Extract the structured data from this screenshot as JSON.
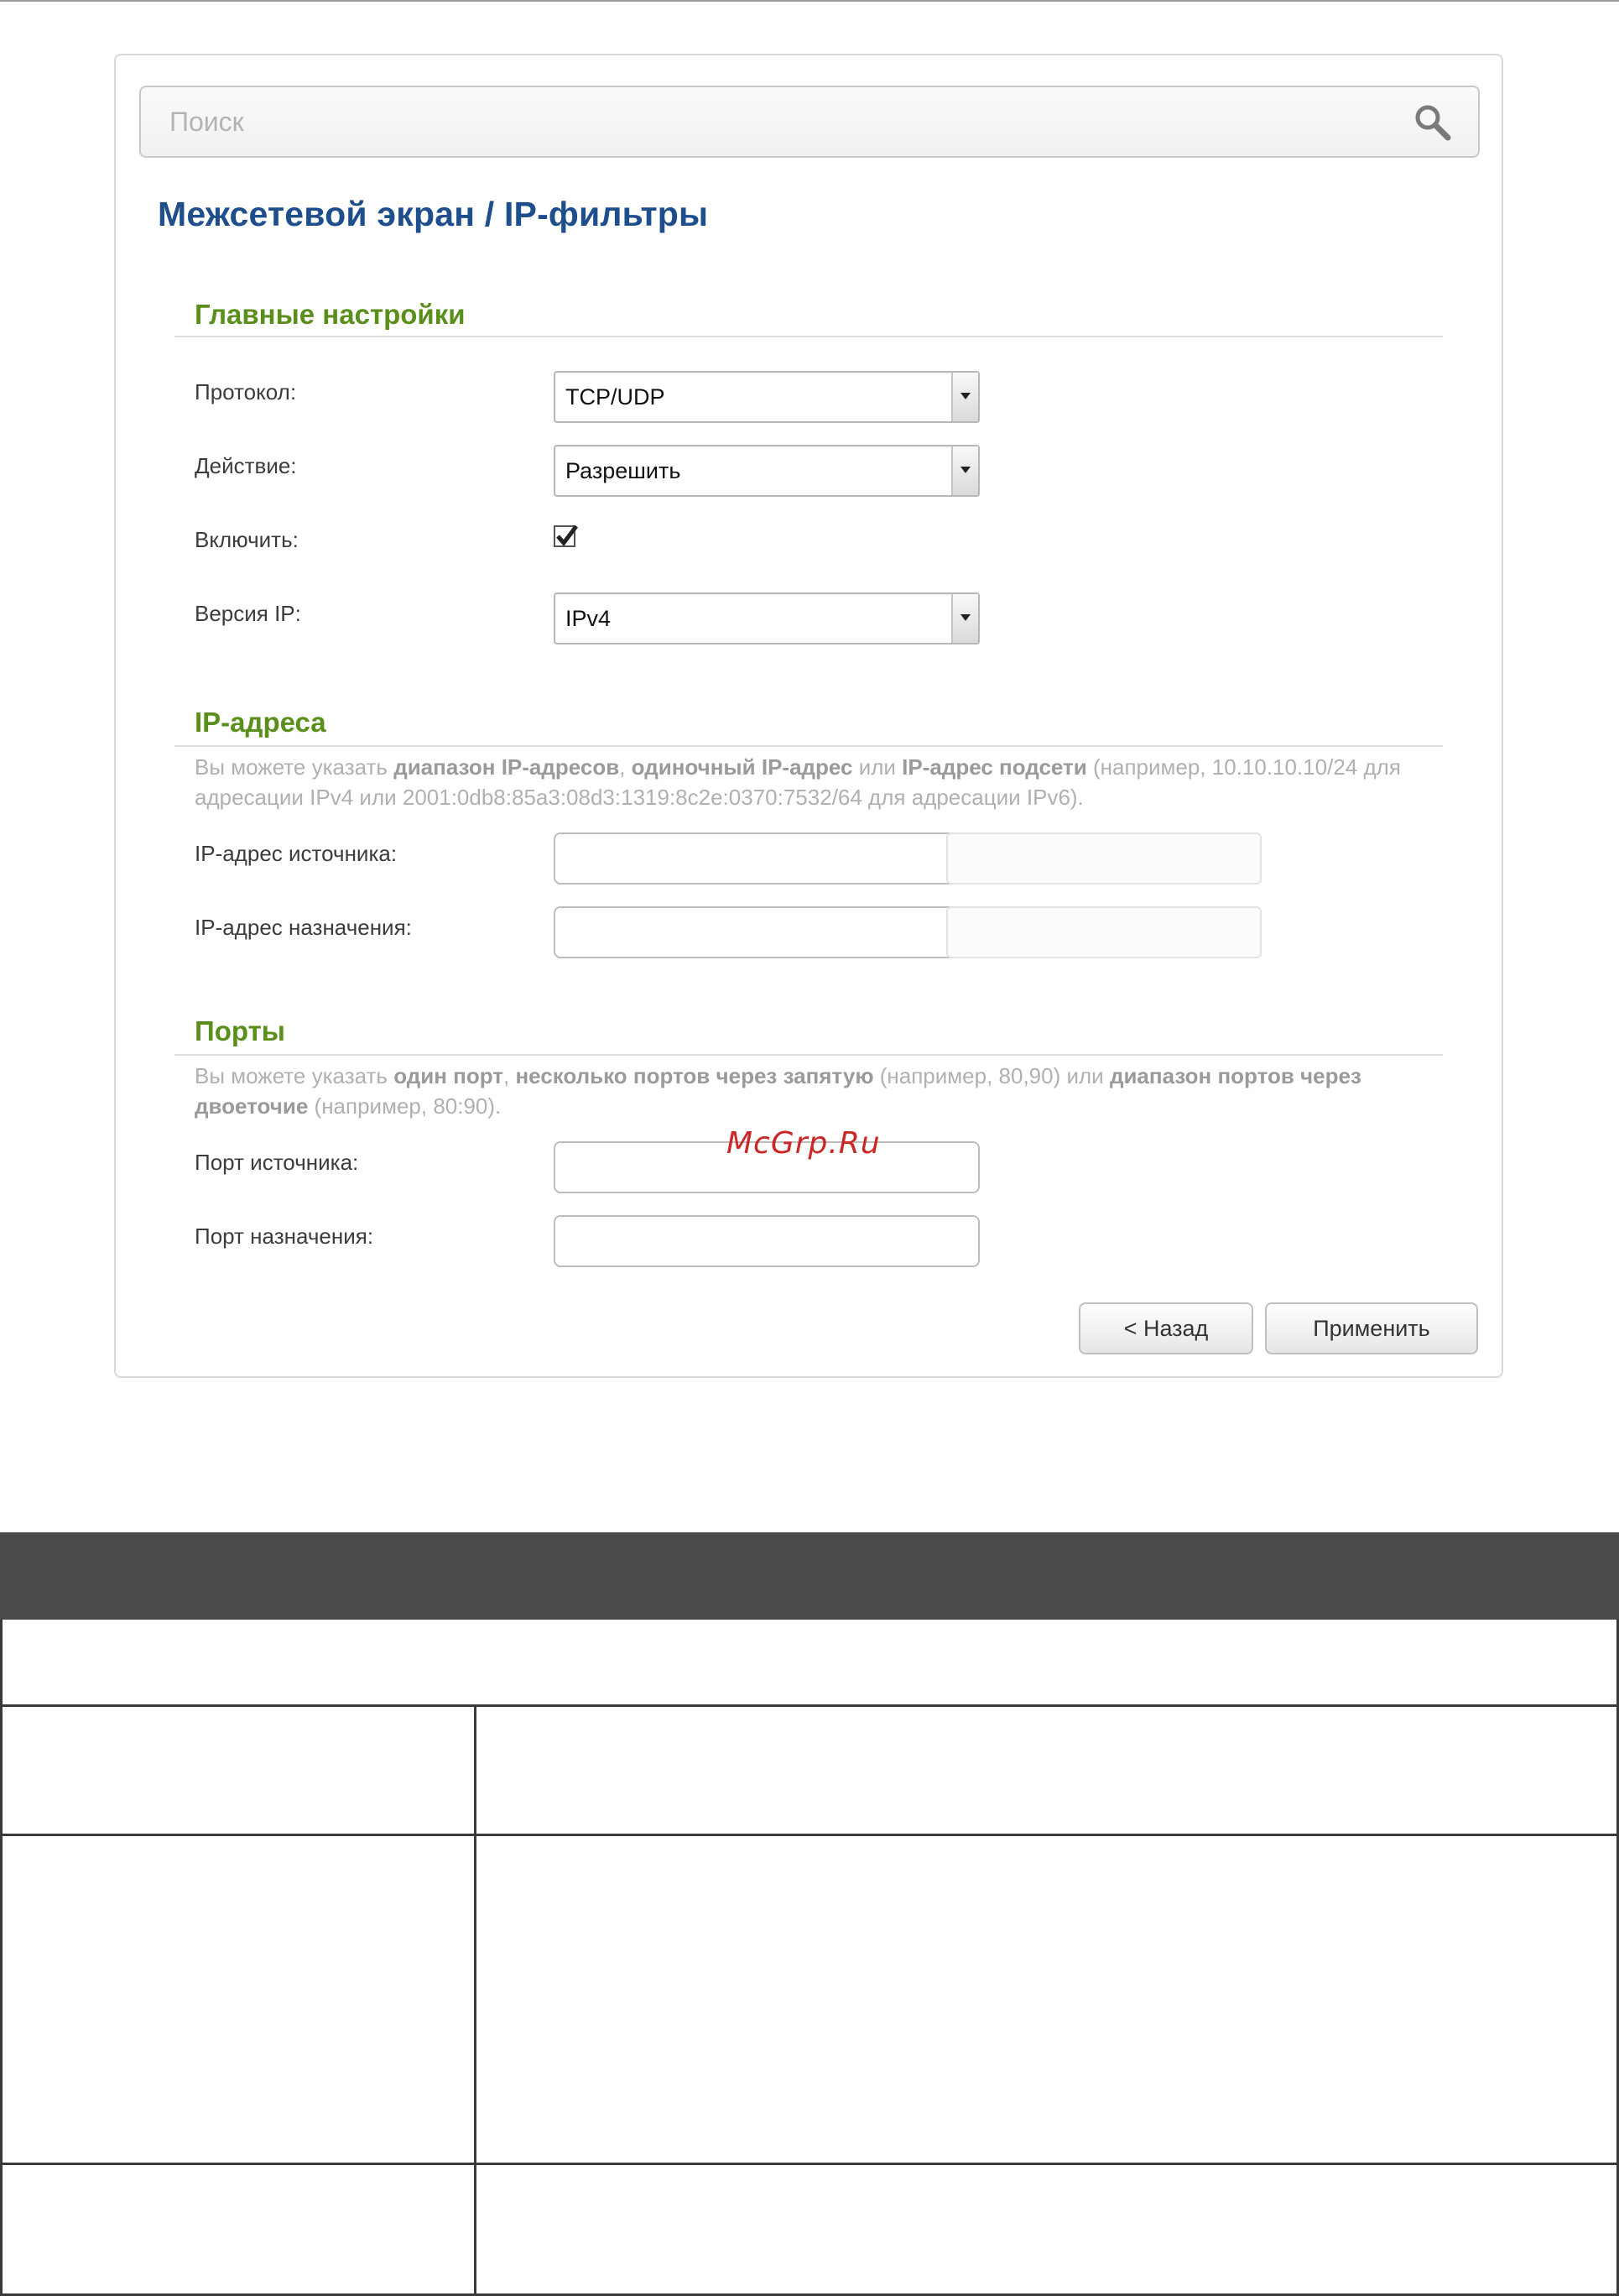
{
  "search": {
    "placeholder": "Поиск"
  },
  "page_title": "Межсетевой экран /  IP-фильтры",
  "main_settings": {
    "title": "Главные настройки",
    "protocol": {
      "label": "Протокол:",
      "value": "TCP/UDP"
    },
    "action": {
      "label": "Действие:",
      "value": "Разрешить"
    },
    "enable": {
      "label": "Включить:",
      "checked": true
    },
    "ip_version": {
      "label": "Версия IP:",
      "value": "IPv4"
    }
  },
  "ip_addresses": {
    "title": "IP-адреса",
    "desc": {
      "t1": "Вы можете указать ",
      "b1": "диапазон IP-адресов",
      "t2": ", ",
      "b2": "одиночный IP-адрес",
      "t3": " или ",
      "b3": "IP-адрес подсети",
      "t4": " (например, 10.10.10.10/24 для адресации IPv4 или 2001:0db8:85a3:08d3:1319:8c2e:0370:7532/64 для адресации IPv6)."
    },
    "source": {
      "label": "IP-адрес источника:"
    },
    "destination": {
      "label": "IP-адрес назначения:"
    }
  },
  "ports": {
    "title": "Порты",
    "desc": {
      "t1": "Вы можете указать ",
      "b1": "один порт",
      "t2": ", ",
      "b2": "несколько портов через запятую",
      "t3": " (например, 80,90) или ",
      "b3": "диапазон портов через двоеточие",
      "t4": " (например, 80:90)."
    },
    "source": {
      "label": "Порт источника:"
    },
    "destination": {
      "label": "Порт назначения:"
    }
  },
  "buttons": {
    "back": "< Назад",
    "apply": "Применить"
  },
  "watermark": "McGrp.Ru",
  "colors": {
    "title_blue": "#1f4e8c",
    "section_green": "#5a8f1c",
    "table_header": "#4a4a4a"
  }
}
